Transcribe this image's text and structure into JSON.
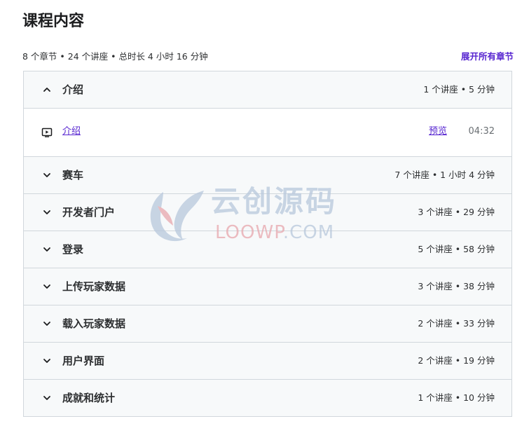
{
  "header": {
    "title": "课程内容",
    "summary": "8 个章节 • 24 个讲座 • 总时长 4 小时 16 分钟",
    "expand_all": "展开所有章节"
  },
  "colors": {
    "accent": "#5624d0",
    "border": "#d1d7dc",
    "section_bg": "#f7f9fa"
  },
  "sections": [
    {
      "title": "介绍",
      "meta": "1 个讲座 • 5 分钟",
      "expanded": true,
      "lectures": [
        {
          "title": "介绍",
          "preview": "预览",
          "duration": "04:32",
          "icon": "video-play-icon"
        }
      ]
    },
    {
      "title": "赛车",
      "meta": "7 个讲座 • 1 小时 4 分钟",
      "expanded": false
    },
    {
      "title": "开发者门户",
      "meta": "3 个讲座 • 29 分钟",
      "expanded": false
    },
    {
      "title": "登录",
      "meta": "5 个讲座 • 58 分钟",
      "expanded": false
    },
    {
      "title": "上传玩家数据",
      "meta": "3 个讲座 • 38 分钟",
      "expanded": false
    },
    {
      "title": "载入玩家数据",
      "meta": "2 个讲座 • 33 分钟",
      "expanded": false
    },
    {
      "title": "用户界面",
      "meta": "2 个讲座 • 19 分钟",
      "expanded": false
    },
    {
      "title": "成就和统计",
      "meta": "1 个讲座 • 10 分钟",
      "expanded": false
    }
  ],
  "watermark": {
    "name_cn": "云创源码",
    "name_en_main": "LOOWP",
    "name_en_suffix": ".COM"
  }
}
